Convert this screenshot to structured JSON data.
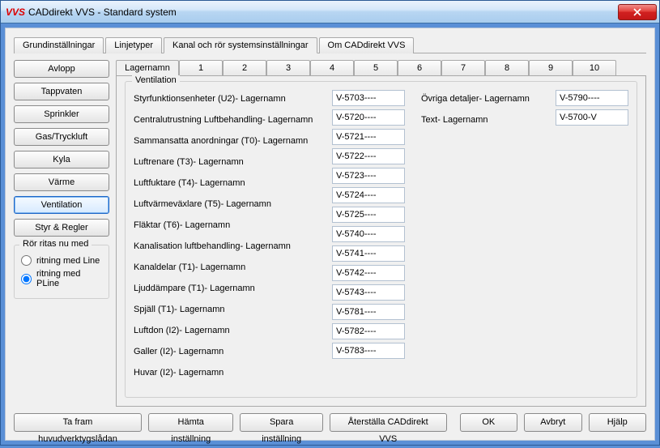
{
  "window": {
    "logo": "VVS",
    "title": "CADdirekt VVS - Standard system"
  },
  "mainTabs": [
    {
      "label": "Grundinställningar",
      "active": false
    },
    {
      "label": "Linjetyper",
      "active": false
    },
    {
      "label": "Kanal och rör systemsinställningar",
      "active": true
    },
    {
      "label": "Om CADdirekt VVS",
      "active": false
    }
  ],
  "sidebar": {
    "buttons": [
      {
        "label": "Avlopp",
        "active": false
      },
      {
        "label": "Tappvaten",
        "active": false
      },
      {
        "label": "Sprinkler",
        "active": false
      },
      {
        "label": "Gas/Tryckluft",
        "active": false
      },
      {
        "label": "Kyla",
        "active": false
      },
      {
        "label": "Värme",
        "active": false
      },
      {
        "label": "Ventilation",
        "active": true
      },
      {
        "label": "Styr & Regler",
        "active": false
      }
    ],
    "radioGroup": {
      "legend": "Rör ritas nu med",
      "options": [
        {
          "label": "ritning med Line",
          "checked": false
        },
        {
          "label": "ritning med PLine",
          "checked": true
        }
      ]
    }
  },
  "subTabs": {
    "first": "Lagernamn",
    "numbers": [
      "1",
      "2",
      "3",
      "4",
      "5",
      "6",
      "7",
      "8",
      "9",
      "10"
    ]
  },
  "fieldsetLegend": "Ventilation",
  "rows": [
    {
      "label": "Styrfunktionsenheter (U2)- Lagernamn",
      "value": "V-5703----"
    },
    {
      "label": "Centralutrustning Luftbehandling- Lagernamn",
      "value": "V-5720----"
    },
    {
      "label": "Sammansatta anordningar (T0)- Lagernamn",
      "value": "V-5721----"
    },
    {
      "label": "Luftrenare (T3)- Lagernamn",
      "value": "V-5722----"
    },
    {
      "label": "Luftfuktare (T4)- Lagernamn",
      "value": "V-5723----"
    },
    {
      "label": "Luftvärmeväxlare (T5)- Lagernamn",
      "value": "V-5724----"
    },
    {
      "label": "Fläktar (T6)- Lagernamn",
      "value": "V-5725----"
    },
    {
      "label": "Kanalisation luftbehandling- Lagernamn",
      "value": "V-5740----"
    },
    {
      "label": "Kanaldelar (T1)- Lagernamn",
      "value": "V-5741----"
    },
    {
      "label": "Ljuddämpare (T1)- Lagernamn",
      "value": "V-5742----"
    },
    {
      "label": "Spjäll (T1)- Lagernamn",
      "value": "V-5743----"
    },
    {
      "label": "Luftdon (I2)- Lagernamn",
      "value": "V-5781----"
    },
    {
      "label": "Galler (I2)- Lagernamn",
      "value": "V-5782----"
    },
    {
      "label": "Huvar (I2)- Lagernamn",
      "value": "V-5783----"
    }
  ],
  "rightRows": [
    {
      "label": "Övriga detaljer- Lagernamn",
      "value": "V-5790----"
    },
    {
      "label": "Text- Lagernamn",
      "value": "V-5700-V"
    }
  ],
  "footer": {
    "btns": [
      "Ta fram huvudverktygslådan",
      "Hämta inställning",
      "Spara inställning",
      "Återställa CADdirekt VVS",
      "OK",
      "Avbryt",
      "Hjälp"
    ]
  }
}
